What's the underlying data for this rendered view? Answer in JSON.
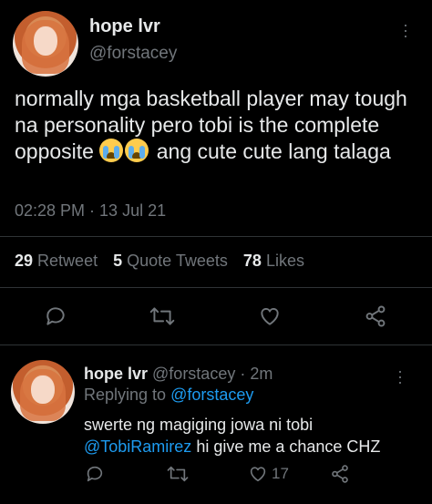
{
  "tweet": {
    "display_name": "hope lvr",
    "handle": "@forstacey",
    "text_part1": "normally mga basketball player may tough na personality pero tobi is the complete opposite",
    "text_part2": "ang cute cute lang talaga",
    "timestamp": "02:28 PM · 13 Jul 21",
    "stats": {
      "retweets_count": "29",
      "retweets_label": "Retweet",
      "quotes_count": "5",
      "quotes_label": "Quote Tweets",
      "likes_count": "78",
      "likes_label": "Likes"
    },
    "actions": [
      "reply-icon",
      "retweet-icon",
      "like-icon",
      "share-icon"
    ]
  },
  "reply": {
    "display_name": "hope lvr",
    "handle": "@forstacey",
    "time": "· 2m",
    "replying_prefix": "Replying to",
    "replying_handle": "@forstacey",
    "line1": "swerte ng magiging jowa ni tobi",
    "mention": "@TobiRamirez",
    "line2_rest": "hi give me a chance CHZ",
    "likes": "17"
  },
  "colors": {
    "background": "#000000",
    "text": "#e7e9ea",
    "muted": "#71767b",
    "link": "#1d9bf0",
    "divider": "#2f3336"
  }
}
